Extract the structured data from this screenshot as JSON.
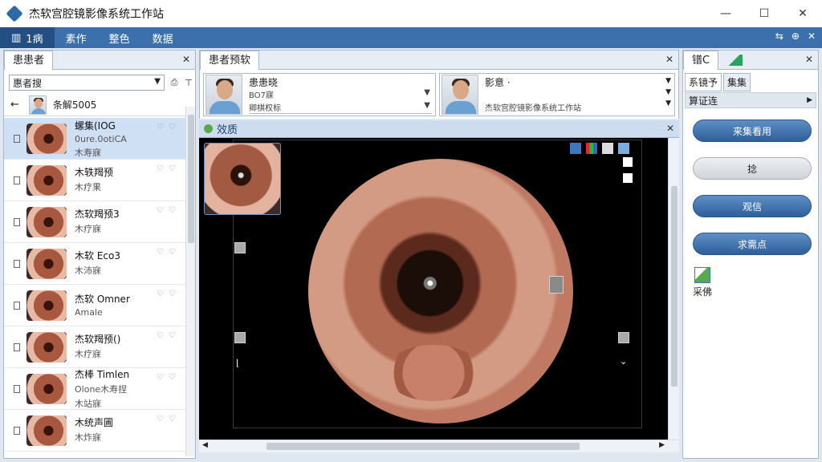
{
  "window": {
    "title": "杰软宫腔镜影像系统工作站",
    "min": "—",
    "max": "☐",
    "close": "✕"
  },
  "menu": {
    "items": [
      "1病",
      "素作",
      "整色",
      "数据"
    ],
    "right_icons": [
      "⇆",
      "⊕",
      "✕"
    ]
  },
  "left_panel": {
    "tab": "患患者",
    "search_value": "惠者搜",
    "current_patient": "条解5005",
    "patients": [
      {
        "name": "螺集(IOG",
        "sub1": "0ure.0otiCA",
        "sub2": "木寿寐",
        "selected": true
      },
      {
        "name": "木轶羯预",
        "sub1": "木疗果",
        "sub2": ""
      },
      {
        "name": "杰软羯预3",
        "sub1": "木疗寐",
        "sub2": ""
      },
      {
        "name": "木软 Eco3",
        "sub1": "木沛寐",
        "sub2": ""
      },
      {
        "name": "杰软 Omner",
        "sub1": "Amale",
        "sub2": ""
      },
      {
        "name": "杰软羯预()",
        "sub1": "木疗寐",
        "sub2": ""
      },
      {
        "name": "杰棒 Timlen",
        "sub1": "Olone木寿捏",
        "sub2": "木站寐"
      },
      {
        "name": "木统声圃",
        "sub1": "木炸寐",
        "sub2": ""
      }
    ]
  },
  "center_panel": {
    "tab": "患者预软",
    "card1": {
      "line1": "患患晓",
      "line2": "BO7寐",
      "line3": "卿棋权标"
    },
    "card2": {
      "line1": "影意 ·",
      "line2": "杰软宫腔镜影像系统工作站"
    },
    "viewer_title": "效质"
  },
  "right_panel": {
    "tab": "镨C",
    "subtabs": [
      "系镜予",
      "集集"
    ],
    "section": "算证连",
    "buttons": [
      "来集看用",
      "捻",
      "观信",
      "求需点"
    ],
    "tool_label": "采佛"
  }
}
